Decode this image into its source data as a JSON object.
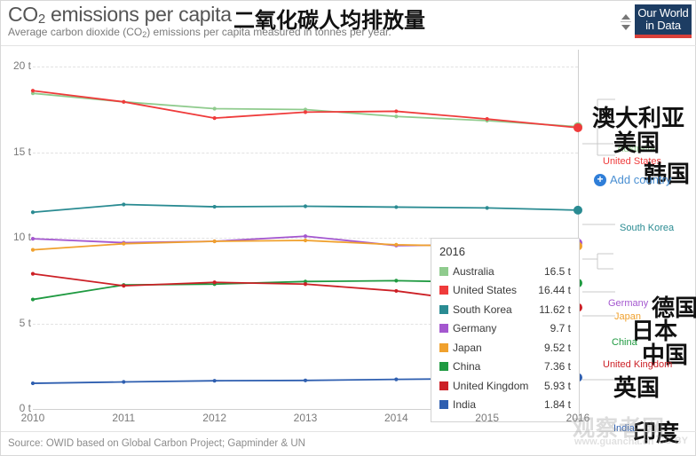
{
  "header": {
    "title_en": "CO2 emissions per capita",
    "title_en_main": "CO",
    "title_en_sub": "2",
    "title_en_rest": " emissions per capita",
    "title_cn": "二氧化碳人均排放量",
    "subtitle_a": "Average carbon dioxide (CO",
    "subtitle_sub": "2",
    "subtitle_b": ") emissions per capita measured in tonnes per year.",
    "logo_line1": "Our World",
    "logo_line2": "in Data"
  },
  "footer": {
    "source": "Source: OWID based on Global Carbon Project; Gapminder & UN",
    "watermark_cn": "观察者网",
    "watermark_url": "www.guancha.cn",
    "watermark_cc": "CC BY"
  },
  "controls": {
    "add_country_label": "Add country",
    "add_country_icon": "plus-circle-icon"
  },
  "tooltip": {
    "year": "2016",
    "rows": [
      {
        "name": "Australia",
        "value": "16.5 t",
        "color": "#8fcb8d"
      },
      {
        "name": "United States",
        "value": "16.44 t",
        "color": "#ef3b3b"
      },
      {
        "name": "South Korea",
        "value": "11.62 t",
        "color": "#2a8b92"
      },
      {
        "name": "Germany",
        "value": "9.7 t",
        "color": "#a457cf"
      },
      {
        "name": "Japan",
        "value": "9.52 t",
        "color": "#f0a12e"
      },
      {
        "name": "China",
        "value": "7.36 t",
        "color": "#1f9a41"
      },
      {
        "name": "United Kingdom",
        "value": "5.93 t",
        "color": "#cc2026"
      },
      {
        "name": "India",
        "value": "1.84 t",
        "color": "#2f5fb0"
      }
    ]
  },
  "right_labels": [
    {
      "name": "Australia",
      "cn": "澳大利亚",
      "color": "#8fcb8d"
    },
    {
      "name": "United States",
      "cn": "美国",
      "color": "#ef3b3b"
    },
    {
      "name": "South Korea",
      "cn": "韩国",
      "color": "#2a8b92"
    },
    {
      "name": "Germany",
      "cn": "德国",
      "color": "#a457cf"
    },
    {
      "name": "Japan",
      "cn": "日本",
      "color": "#f0a12e"
    },
    {
      "name": "China",
      "cn": "中国",
      "color": "#1f9a41"
    },
    {
      "name": "United Kingdom",
      "cn": "英国",
      "color": "#cc2026"
    },
    {
      "name": "India",
      "cn": "印度",
      "color": "#2f5fb0"
    }
  ],
  "chart_data": {
    "type": "line",
    "title": "CO2 emissions per capita",
    "subtitle": "Average carbon dioxide (CO2) emissions per capita measured in tonnes per year.",
    "xlabel": "",
    "ylabel": "",
    "unit": "t",
    "x": [
      2010,
      2011,
      2012,
      2013,
      2014,
      2015,
      2016
    ],
    "xtick_labels": [
      "2010",
      "2011",
      "2012",
      "2013",
      "2014",
      "2015",
      "2016"
    ],
    "ytick_labels": [
      "0 t",
      "5 t",
      "10 t",
      "15 t",
      "20 t"
    ],
    "yticks": [
      0,
      5,
      10,
      15,
      20
    ],
    "ylim": [
      0,
      21
    ],
    "xlim": [
      2010,
      2016
    ],
    "grid": true,
    "legend": "right-labels",
    "highlight_year": 2016,
    "series": [
      {
        "name": "Australia",
        "color": "#8fcb8d",
        "values": [
          18.45,
          17.95,
          17.55,
          17.5,
          17.1,
          16.85,
          16.5
        ]
      },
      {
        "name": "United States",
        "color": "#ef3b3b",
        "values": [
          18.6,
          17.95,
          17.0,
          17.35,
          17.4,
          16.95,
          16.44
        ]
      },
      {
        "name": "South Korea",
        "color": "#2a8b92",
        "values": [
          11.5,
          11.95,
          11.82,
          11.85,
          11.8,
          11.75,
          11.62
        ]
      },
      {
        "name": "Germany",
        "color": "#a457cf",
        "values": [
          9.95,
          9.72,
          9.8,
          10.1,
          9.55,
          9.6,
          9.7
        ]
      },
      {
        "name": "Japan",
        "color": "#f0a12e",
        "values": [
          9.3,
          9.66,
          9.8,
          9.85,
          9.6,
          9.5,
          9.52
        ]
      },
      {
        "name": "China",
        "color": "#1f9a41",
        "values": [
          6.4,
          7.25,
          7.3,
          7.45,
          7.5,
          7.4,
          7.36
        ]
      },
      {
        "name": "United Kingdom",
        "color": "#cc2026",
        "values": [
          7.9,
          7.2,
          7.4,
          7.3,
          6.9,
          6.2,
          5.93
        ]
      },
      {
        "name": "India",
        "color": "#2f5fb0",
        "values": [
          1.5,
          1.58,
          1.65,
          1.67,
          1.73,
          1.78,
          1.84
        ]
      }
    ]
  }
}
